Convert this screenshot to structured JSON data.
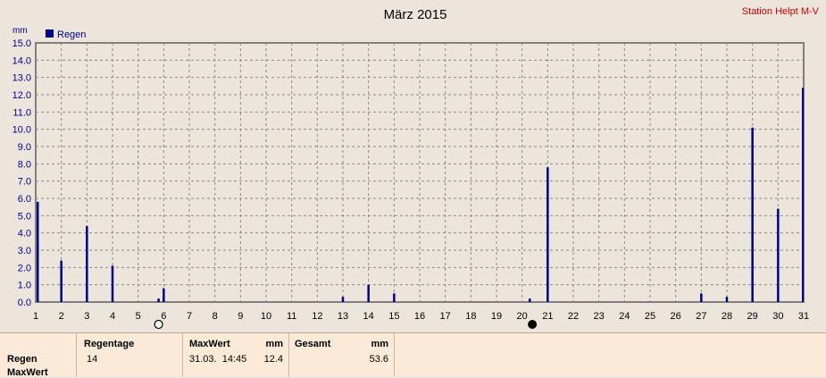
{
  "header": {
    "title": "März 2015",
    "station": "Station Helpt M-V"
  },
  "chart_data": {
    "type": "bar",
    "title": "März 2015",
    "ylabel": "mm",
    "ylim": [
      0,
      15
    ],
    "yticks": [
      "0.0",
      "1.0",
      "2.0",
      "3.0",
      "4.0",
      "5.0",
      "6.0",
      "7.0",
      "8.0",
      "9.0",
      "10.0",
      "11.0",
      "12.0",
      "13.0",
      "14.0",
      "15.0"
    ],
    "xlim": [
      1,
      31
    ],
    "xticks": [
      "1",
      "2",
      "3",
      "4",
      "5",
      "6",
      "7",
      "8",
      "9",
      "10",
      "11",
      "12",
      "13",
      "14",
      "15",
      "16",
      "17",
      "18",
      "19",
      "20",
      "21",
      "22",
      "23",
      "24",
      "25",
      "26",
      "27",
      "28",
      "29",
      "30",
      "31"
    ],
    "grid": true,
    "legend_position": "top-left",
    "series": [
      {
        "name": "Regen",
        "color": "#00008b",
        "points": [
          {
            "x": 1,
            "y": 5.8
          },
          {
            "x": 2,
            "y": 2.4
          },
          {
            "x": 3,
            "y": 4.4
          },
          {
            "x": 4,
            "y": 2.1
          },
          {
            "x": 5.8,
            "y": 0.2
          },
          {
            "x": 6,
            "y": 0.8
          },
          {
            "x": 13,
            "y": 0.3
          },
          {
            "x": 14,
            "y": 1.0
          },
          {
            "x": 15,
            "y": 0.5
          },
          {
            "x": 20.3,
            "y": 0.2
          },
          {
            "x": 21,
            "y": 7.8
          },
          {
            "x": 27,
            "y": 0.5
          },
          {
            "x": 28,
            "y": 0.3
          },
          {
            "x": 29,
            "y": 10.1
          },
          {
            "x": 30,
            "y": 5.4
          },
          {
            "x": 31,
            "y": 12.4
          }
        ]
      }
    ],
    "moon_phases": [
      {
        "x": 5.8,
        "phase": "full-moon"
      },
      {
        "x": 20.4,
        "phase": "new-moon"
      }
    ]
  },
  "summary": {
    "row_labels": [
      "Regen",
      "MaxWert"
    ],
    "regentage_header": "Regentage",
    "regentage_value": "14",
    "maxwert_header": "MaxWert",
    "maxwert_unit": "mm",
    "maxwert_date": "31.03.  14:45",
    "maxwert_value": "12.4",
    "gesamt_header": "Gesamt",
    "gesamt_unit": "mm",
    "gesamt_value": "53.6"
  }
}
